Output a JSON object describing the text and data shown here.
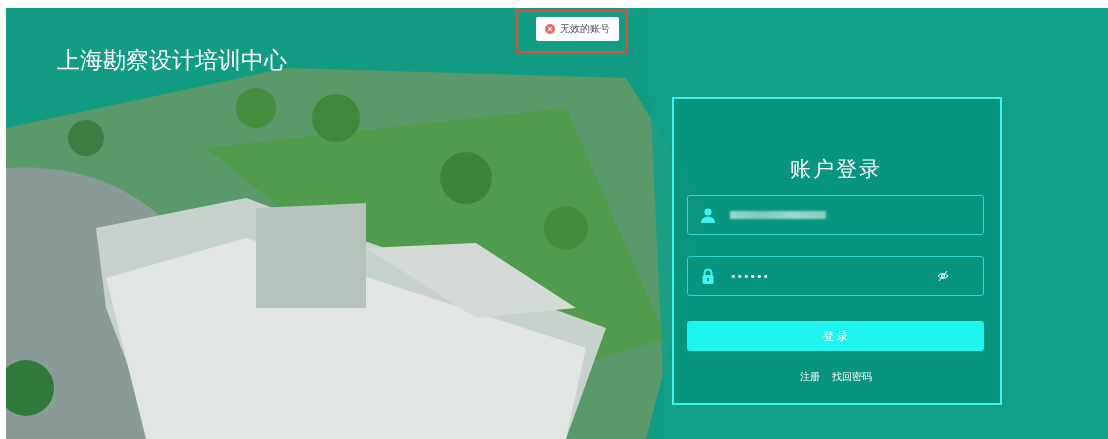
{
  "title": "上海勘察设计培训中心",
  "toast": {
    "kind": "error",
    "message": "无效的账号",
    "highlighted": true
  },
  "login": {
    "heading": "账户登录",
    "fields": [
      {
        "kind": "user",
        "redacted": true
      },
      {
        "kind": "password",
        "value": "••••••",
        "toggle": true
      }
    ],
    "submit": "登 录",
    "links": [
      "注册",
      "找回密码"
    ]
  }
}
